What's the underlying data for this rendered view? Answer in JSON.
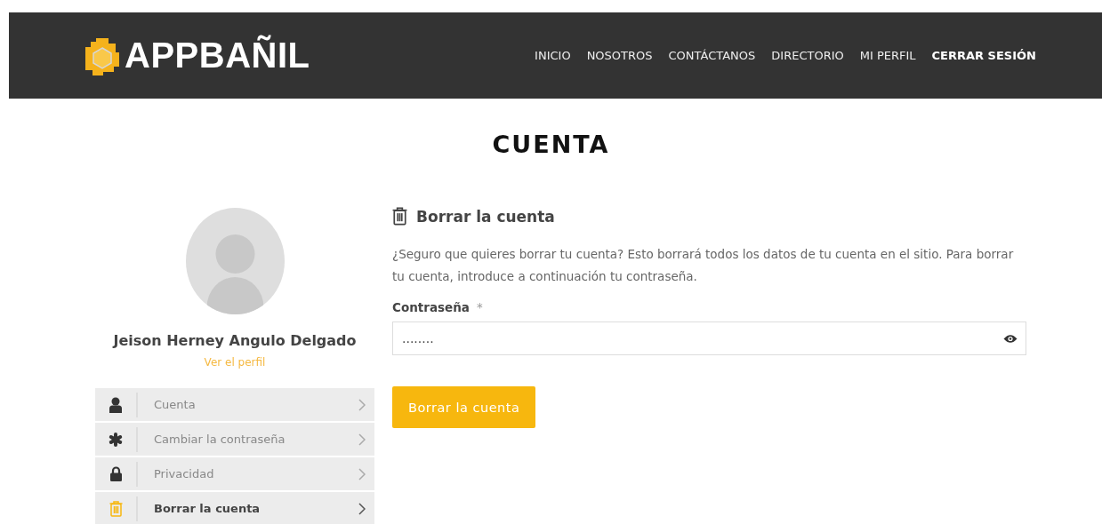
{
  "header": {
    "logo": "APPBAÑIL",
    "nav": [
      {
        "label": "INICIO",
        "bold": false
      },
      {
        "label": "NOSOTROS",
        "bold": false
      },
      {
        "label": "CONTÁCTANOS",
        "bold": false
      },
      {
        "label": "DIRECTORIO",
        "bold": false
      },
      {
        "label": "MI PERFIL",
        "bold": false
      },
      {
        "label": "CERRAR SESIÓN",
        "bold": true
      }
    ]
  },
  "page_title": "CUENTA",
  "profile": {
    "name": "Jeison Herney Angulo Delgado",
    "link": "Ver el perfil"
  },
  "menu": [
    {
      "kind": "user",
      "label": "Cuenta",
      "selected": false
    },
    {
      "kind": "asterisk",
      "label": "Cambiar la contraseña",
      "selected": false
    },
    {
      "kind": "lock",
      "label": "Privacidad",
      "selected": false
    },
    {
      "kind": "trash",
      "label": "Borrar la cuenta",
      "selected": true
    }
  ],
  "section": {
    "title": "Borrar la cuenta",
    "description": "¿Seguro que quieres borrar tu cuenta? Esto borrará todos los datos de tu cuenta en el sitio. Para borrar tu cuenta, introduce a continuación tu contraseña.",
    "field_label": "Contraseña",
    "required_mark": "*",
    "password_value": "........",
    "button": "Borrar la cuenta"
  }
}
